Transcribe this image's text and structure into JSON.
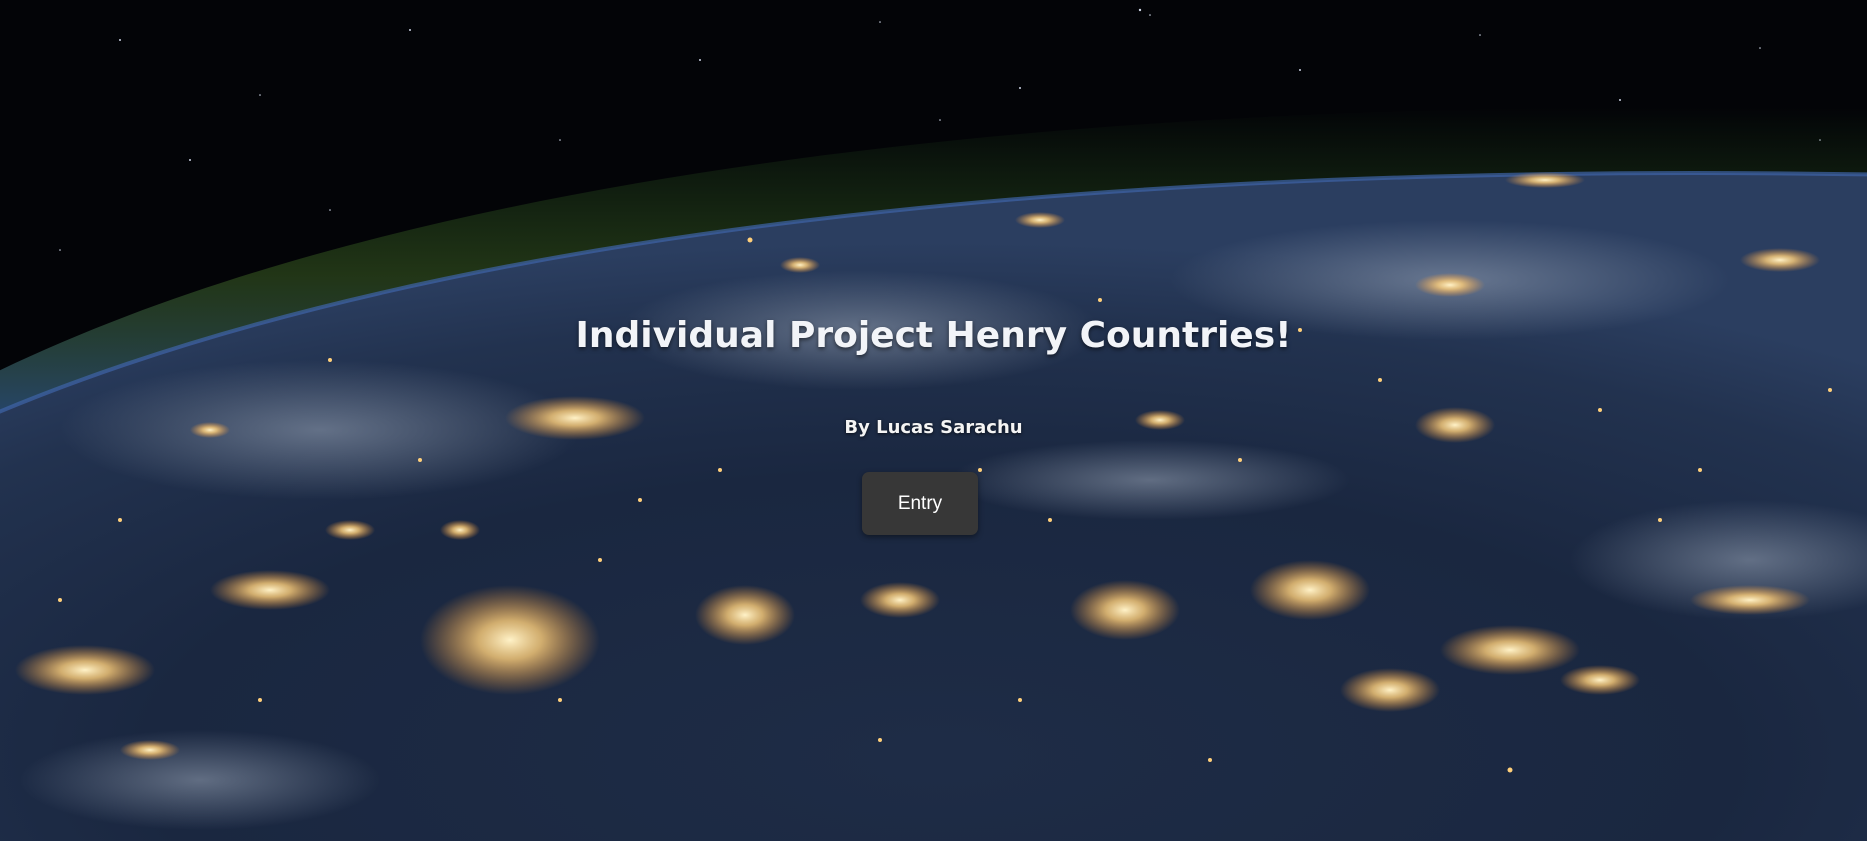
{
  "page": {
    "title": "Individual Project Henry Countries!",
    "author_line": "By Lucas Sarachu",
    "entry_button_label": "Entry"
  },
  "background": {
    "description_icon": "earth-at-night-image",
    "space_color": "#030407",
    "ocean_color": "#1a2a44",
    "city_light_color": "#ffd58a",
    "atmosphere_color": "#2f6a2a"
  }
}
